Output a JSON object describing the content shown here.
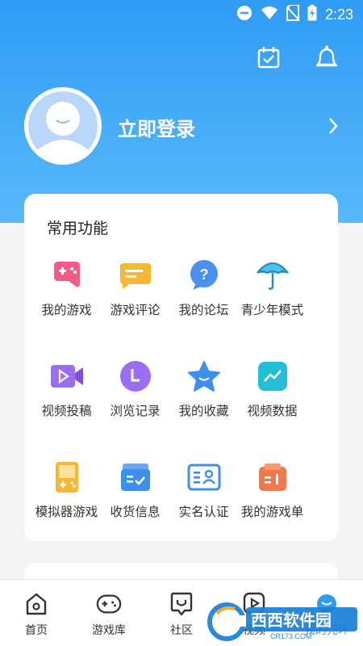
{
  "status_bar": {
    "time": "2:23"
  },
  "profile": {
    "login_label": "立即登录"
  },
  "common_features": {
    "title": "常用功能",
    "items": [
      {
        "label": "我的游戏",
        "icon": "gamepad-icon"
      },
      {
        "label": "游戏评论",
        "icon": "comment-icon"
      },
      {
        "label": "我的论坛",
        "icon": "question-bubble-icon"
      },
      {
        "label": "青少年模式",
        "icon": "umbrella-icon"
      },
      {
        "label": "视频投稿",
        "icon": "video-camera-icon"
      },
      {
        "label": "浏览记录",
        "icon": "clock-icon"
      },
      {
        "label": "我的收藏",
        "icon": "star-icon"
      },
      {
        "label": "视频数据",
        "icon": "chart-icon"
      },
      {
        "label": "模拟器游戏",
        "icon": "gameboy-icon"
      },
      {
        "label": "收货信息",
        "icon": "package-icon"
      },
      {
        "label": "实名认证",
        "icon": "id-card-icon"
      },
      {
        "label": "我的游戏单",
        "icon": "game-list-icon"
      }
    ]
  },
  "tabbar": {
    "tabs": [
      {
        "label": "首页",
        "icon": "home-icon"
      },
      {
        "label": "游戏库",
        "icon": "game-library-icon"
      },
      {
        "label": "社区",
        "icon": "community-icon"
      },
      {
        "label": "视频",
        "icon": "video-play-icon"
      },
      {
        "label": "我的元环",
        "icon": "profile-icon"
      }
    ],
    "active_index": 4
  },
  "watermark": {
    "text": "西西软件园",
    "sub": "CR173.COM"
  },
  "colors": {
    "brand": "#2f9bf5",
    "header_gradient_end": "#58b8fa"
  }
}
